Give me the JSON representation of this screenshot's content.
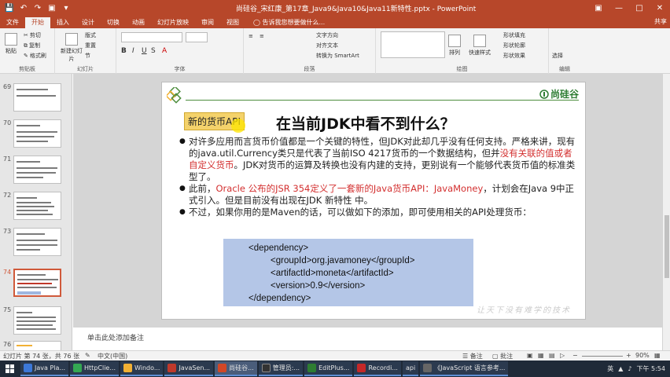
{
  "window": {
    "title": "尚硅谷_宋红康_第17章_Java9&Java10&Java11新特性.pptx - PowerPoint"
  },
  "tabs": [
    "文件",
    "开始",
    "插入",
    "设计",
    "切换",
    "动画",
    "幻灯片放映",
    "审阅",
    "视图"
  ],
  "tell_me": "告诉我您想要做什么...",
  "share": "共享",
  "ribbon": {
    "clipboard": {
      "paste": "粘贴",
      "cut": "剪切",
      "copy": "复制",
      "format_painter": "格式刷",
      "label": "剪贴板"
    },
    "slides": {
      "new_slide": "新建幻灯片",
      "layout": "版式",
      "reset": "重置",
      "section": "节",
      "label": "幻灯片"
    },
    "font": {
      "label": "字体"
    },
    "paragraph": {
      "text_direction": "文字方向",
      "align_text": "对齐文本",
      "smartart": "转换为 SmartArt",
      "label": "段落"
    },
    "drawing": {
      "arrange": "排列",
      "quick_styles": "快速样式",
      "shape_fill": "形状填充",
      "shape_outline": "形状轮廓",
      "shape_effects": "形状效果",
      "label": "绘图"
    },
    "editing": {
      "select": "选择",
      "label": "编辑"
    }
  },
  "thumbnails": [
    {
      "num": "69"
    },
    {
      "num": "70"
    },
    {
      "num": "71"
    },
    {
      "num": "72"
    },
    {
      "num": "73"
    },
    {
      "num": "74",
      "selected": true
    },
    {
      "num": "75"
    },
    {
      "num": "76"
    }
  ],
  "slide": {
    "logo_text": "尚硅谷",
    "tag": "新的货币API",
    "title": "在当前JDK中看不到什么？",
    "bullet1_a": "对许多应用而言货币价值都是一个关键的特性，但JDK对此却几乎没有任何支持。严格来讲，现有的java.util.Currency类只是代表了当前ISO 4217货币的一个数据结构，但并",
    "bullet1_red": "没有关联的值或者自定义货币",
    "bullet1_b": "。JDK对货币的运算及转换也没有内建的支持，更别说有一个能够代表货币值的标准类型了。",
    "bullet2_a": "此前，",
    "bullet2_red": "Oracle 公布的JSR 354定义了一套新的Java货币API：JavaMoney",
    "bullet2_b": "，计划会在Java 9中正式引入。但是目前没有出现在JDK 新特性 中。",
    "bullet3": "不过，如果你用的是Maven的话，可以做如下的添加，即可使用相关的API处理货币：",
    "code": {
      "line1": "<dependency>",
      "line2": "<groupId>org.javamoney</groupId>",
      "line3": "<artifactId>moneta</artifactId>",
      "line4": "<version>0.9</version>",
      "line5": "</dependency>"
    },
    "watermark": "让天下没有难学的技术"
  },
  "notes": {
    "placeholder": "单击此处添加备注"
  },
  "status": {
    "slide_info": "幻灯片 第 74 张，共 76 张",
    "language": "中文(中国)",
    "notes": "备注",
    "comments": "批注",
    "zoom": "90%"
  },
  "taskbar": {
    "items": [
      {
        "label": "Java Pla...",
        "color": "#3c78d8"
      },
      {
        "label": "HttpClie...",
        "color": "#34a853"
      },
      {
        "label": "Windo...",
        "color": "#f2b134"
      },
      {
        "label": "JavaSen...",
        "color": "#c0392b"
      },
      {
        "label": "尚硅谷...",
        "color": "#d24726",
        "active": true
      },
      {
        "label": "管理员:...",
        "color": "#333333"
      },
      {
        "label": "EditPlus...",
        "color": "#2e7d32"
      },
      {
        "label": "Recordi...",
        "color": "#c62828"
      },
      {
        "label": "api",
        "color": "#555555"
      },
      {
        "label": "《JavaScript 语言参考...",
        "color": "#666666"
      }
    ],
    "ime": "英",
    "time": "下午 5:54"
  }
}
